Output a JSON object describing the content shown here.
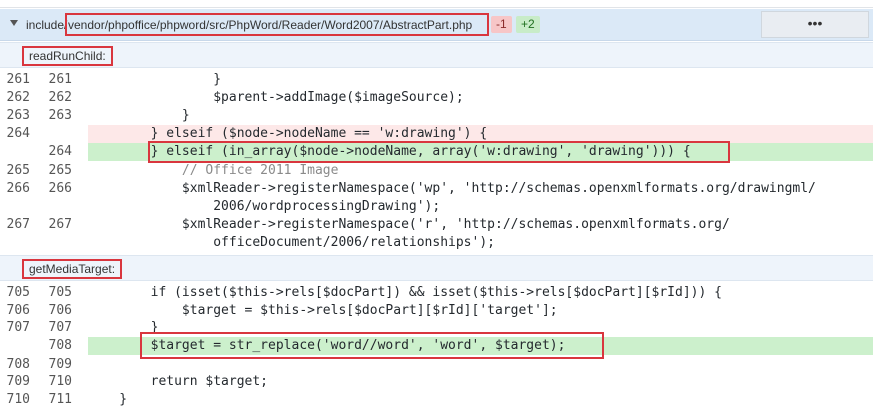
{
  "file": {
    "prefix": "include/",
    "path": "vendor/phpoffice/phpword/src/PhpWord/Reader/Word2007/AbstractPart.php",
    "deletions": "-1",
    "additions": "+2",
    "more_label": "•••"
  },
  "hunks": [
    {
      "label": "readRunChild:",
      "rows": [
        {
          "old": "261",
          "new": "261",
          "type": "ctx",
          "code": "                }"
        },
        {
          "old": "262",
          "new": "262",
          "type": "ctx",
          "code": "                $parent->addImage($imageSource);"
        },
        {
          "old": "263",
          "new": "263",
          "type": "ctx",
          "code": "            }"
        },
        {
          "old": "264",
          "new": "",
          "type": "del",
          "code": "        } elseif ($node->nodeName == 'w:drawing') {"
        },
        {
          "old": "",
          "new": "264",
          "type": "add",
          "code": "        } elseif (in_array($node->nodeName, array('w:drawing', 'drawing'))) {"
        },
        {
          "old": "265",
          "new": "265",
          "type": "ctx",
          "code": "            // Office 2011 Image"
        },
        {
          "old": "266",
          "new": "266",
          "type": "ctx",
          "code": "            $xmlReader->registerNamespace('wp', 'http://schemas.openxmlformats.org/drawingml/"
        },
        {
          "old": "",
          "new": "",
          "type": "ctx",
          "code": "                2006/wordprocessingDrawing');"
        },
        {
          "old": "267",
          "new": "267",
          "type": "ctx",
          "code": "            $xmlReader->registerNamespace('r', 'http://schemas.openxmlformats.org/"
        },
        {
          "old": "",
          "new": "",
          "type": "ctx",
          "code": "                officeDocument/2006/relationships');"
        }
      ]
    },
    {
      "label": "getMediaTarget:",
      "rows": [
        {
          "old": "705",
          "new": "705",
          "type": "ctx",
          "code": "        if (isset($this->rels[$docPart]) && isset($this->rels[$docPart][$rId])) {"
        },
        {
          "old": "706",
          "new": "706",
          "type": "ctx",
          "code": "            $target = $this->rels[$docPart][$rId]['target'];"
        },
        {
          "old": "707",
          "new": "707",
          "type": "ctx",
          "code": "        }"
        },
        {
          "old": "",
          "new": "708",
          "type": "add",
          "code": "        $target = str_replace('word//word', 'word', $target);"
        },
        {
          "old": "708",
          "new": "709",
          "type": "ctx",
          "code": ""
        },
        {
          "old": "709",
          "new": "710",
          "type": "ctx",
          "code": "        return $target;"
        },
        {
          "old": "710",
          "new": "711",
          "type": "ctx",
          "code": "    }"
        }
      ]
    }
  ]
}
